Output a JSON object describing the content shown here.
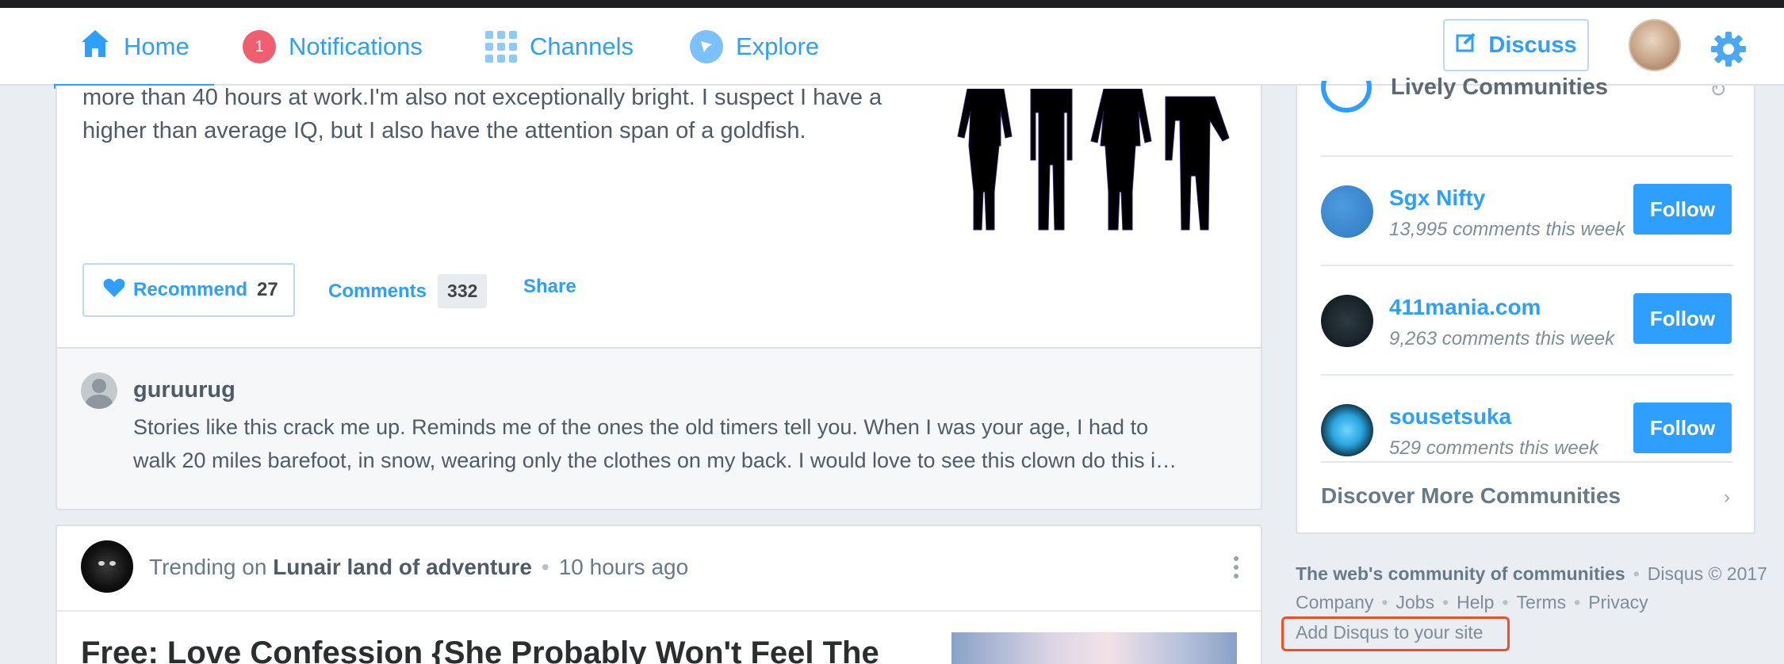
{
  "nav": {
    "home": "Home",
    "notifications": "Notifications",
    "notification_count": "1",
    "channels": "Channels",
    "explore": "Explore",
    "discuss": "Discuss",
    "accent": "#2e9fff"
  },
  "post": {
    "excerpt_line1": "more than 40 hours at work.I'm also not exceptionally bright. I suspect I have a",
    "excerpt_line2": "higher than average IQ, but I also have the attention span of a goldfish.",
    "recommend_label": "Recommend",
    "recommend_count": "27",
    "comments_label": "Comments",
    "comments_count": "332",
    "share_label": "Share"
  },
  "comment": {
    "user": "guruurug",
    "text_line1": "Stories like this crack me up. Reminds me of the ones the old timers tell you. When I was your age, I had to",
    "text_line2": "walk 20 miles barefoot, in snow, wearing only the clothes on my back. I would love to see this clown do this i…"
  },
  "trending": {
    "prefix": "Trending on",
    "community": "Lunair land of adventure",
    "time": "10 hours ago",
    "headline": "Free: Love Confession {She Probably Won't Feel The"
  },
  "sidebar": {
    "title": "Lively Communities",
    "communities": [
      {
        "name": "Sgx Nifty",
        "meta": "13,995 comments this week",
        "follow": "Follow"
      },
      {
        "name": "411mania.com",
        "meta": "9,263 comments this week",
        "follow": "Follow"
      },
      {
        "name": "sousetsuka",
        "meta": "529 comments this week",
        "follow": "Follow"
      }
    ],
    "discover": "Discover More Communities"
  },
  "footer": {
    "tagline": "The web's community of communities",
    "copyright": "Disqus © 2017",
    "links": [
      "Company",
      "Jobs",
      "Help",
      "Terms",
      "Privacy"
    ],
    "add_disqus": "Add Disqus to your site",
    "highlight_color": "#f04e23"
  }
}
